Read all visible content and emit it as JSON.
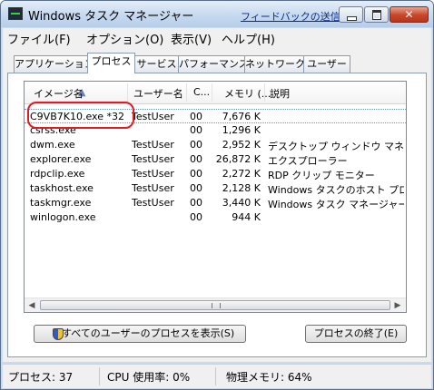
{
  "window": {
    "title": "Windows タスク マネージャー",
    "feedback_link": "フィードバックの送信"
  },
  "menu": [
    "ファイル(F)",
    "オプション(O)",
    "表示(V)",
    "ヘルプ(H)"
  ],
  "tabs": [
    "アプリケーション",
    "プロセス",
    "サービス",
    "パフォーマンス",
    "ネットワーク",
    "ユーザー"
  ],
  "active_tab": "プロセス",
  "columns": {
    "name": "イメージ名",
    "user": "ユーザー名",
    "cpu": "C...",
    "memory": "メモリ (...",
    "description": "説明"
  },
  "processes": [
    {
      "name": "C9VB7K10.exe *32",
      "user": "TestUser",
      "cpu": "00",
      "memory": "7,676 K",
      "description": ""
    },
    {
      "name": "csrss.exe",
      "user": "",
      "cpu": "00",
      "memory": "1,296 K",
      "description": ""
    },
    {
      "name": "dwm.exe",
      "user": "TestUser",
      "cpu": "00",
      "memory": "2,952 K",
      "description": "デスクトップ ウィンドウ マネージャー"
    },
    {
      "name": "explorer.exe",
      "user": "TestUser",
      "cpu": "00",
      "memory": "26,872 K",
      "description": "エクスプローラー"
    },
    {
      "name": "rdpclip.exe",
      "user": "TestUser",
      "cpu": "00",
      "memory": "2,272 K",
      "description": "RDP クリップ モニター"
    },
    {
      "name": "taskhost.exe",
      "user": "TestUser",
      "cpu": "00",
      "memory": "2,128 K",
      "description": "Windows タスクのホスト プロセス"
    },
    {
      "name": "taskmgr.exe",
      "user": "TestUser",
      "cpu": "00",
      "memory": "3,440 K",
      "description": "Windows タスク マネージャー"
    },
    {
      "name": "winlogon.exe",
      "user": "",
      "cpu": "00",
      "memory": "944 K",
      "description": ""
    }
  ],
  "buttons": {
    "show_all": "すべてのユーザーのプロセスを表示(S)",
    "end_process": "プロセスの終了(E)"
  },
  "status": {
    "processes": "プロセス: 37",
    "cpu": "CPU 使用率: 0%",
    "memory": "物理メモリ: 64%"
  },
  "icons": {
    "app": "taskmgr-icon",
    "shield": "uac-shield-icon"
  }
}
